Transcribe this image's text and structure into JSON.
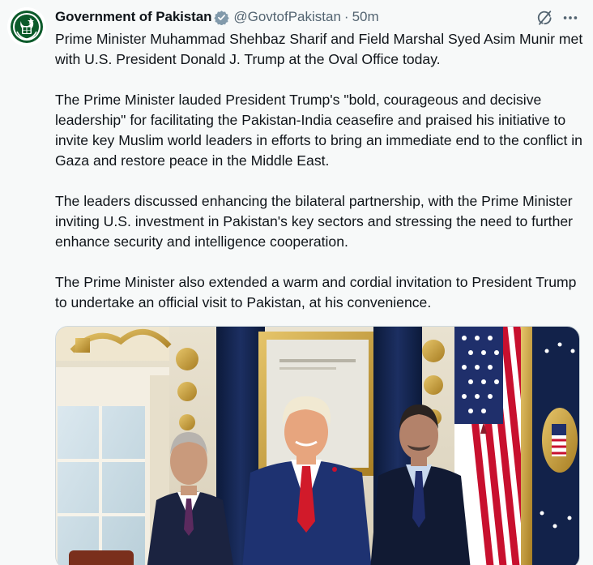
{
  "author": {
    "display_name": "Government of Pakistan",
    "handle": "@GovtofPakistan",
    "separator": "·",
    "timestamp": "50m",
    "verified_badge_color": "#829aab",
    "avatar_icon": "pakistan-emblem-icon"
  },
  "actions": {
    "grok_icon": "grok-icon",
    "more_icon": "more-icon"
  },
  "tweet": {
    "paragraphs": [
      "Prime Minister Muhammad Shehbaz Sharif and Field Marshal Syed Asim Munir met with U.S. President Donald J. Trump at the Oval Office today.",
      "The Prime Minister lauded President Trump's \"bold, courageous and decisive leadership\" for facilitating the Pakistan-India ceasefire and praised his initiative to invite key Muslim world leaders in efforts to bring an immediate end to the conflict in Gaza and restore peace in the Middle East.",
      "The leaders discussed enhancing the bilateral partnership, with the Prime Minister inviting U.S. investment in Pakistan's key sectors and stressing the need to further enhance security and intelligence cooperation.",
      "The Prime Minister also extended a warm and cordial invitation to President Trump to undertake an official visit to Pakistan, at his convenience."
    ]
  },
  "colors": {
    "background": "#f7f9f9",
    "text_primary": "#0f1419",
    "text_secondary": "#536471",
    "emblem_green": "#0b5a2a"
  }
}
